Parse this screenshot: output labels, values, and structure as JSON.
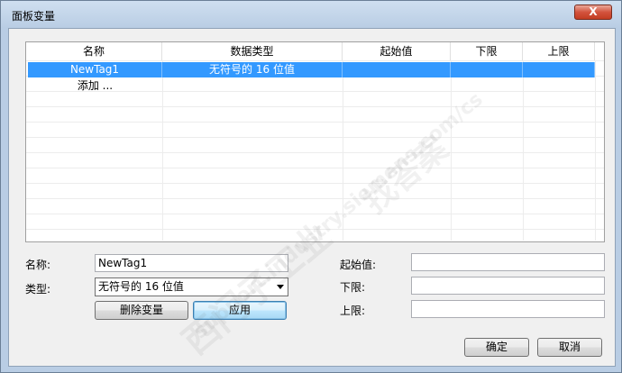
{
  "window": {
    "title": "面板变量",
    "close_label": "X"
  },
  "grid": {
    "columns": [
      "名称",
      "数据类型",
      "起始值",
      "下限",
      "上限"
    ],
    "rows": [
      {
        "name": "NewTag1",
        "type": "无符号的 16 位值",
        "start": "",
        "low": "",
        "high": ""
      }
    ],
    "add_row_label": "添加 ..."
  },
  "form": {
    "name_label": "名称:",
    "name_value": "NewTag1",
    "type_label": "类型:",
    "type_value": "无符号的 16 位值",
    "start_label": "起始值:",
    "start_value": "",
    "low_label": "下限:",
    "low_value": "",
    "high_label": "上限:",
    "high_value": "",
    "delete_label": "删除变量",
    "apply_label": "应用"
  },
  "footer": {
    "ok_label": "确定",
    "cancel_label": "取消"
  },
  "watermark": {
    "line1": "西门子工业",
    "line2": "support.industry.siemens.com/cs",
    "line3": "找答案"
  },
  "colors": {
    "selection": "#3399ff",
    "title_bar": "#b9cde4",
    "close_button": "#c23c22"
  }
}
